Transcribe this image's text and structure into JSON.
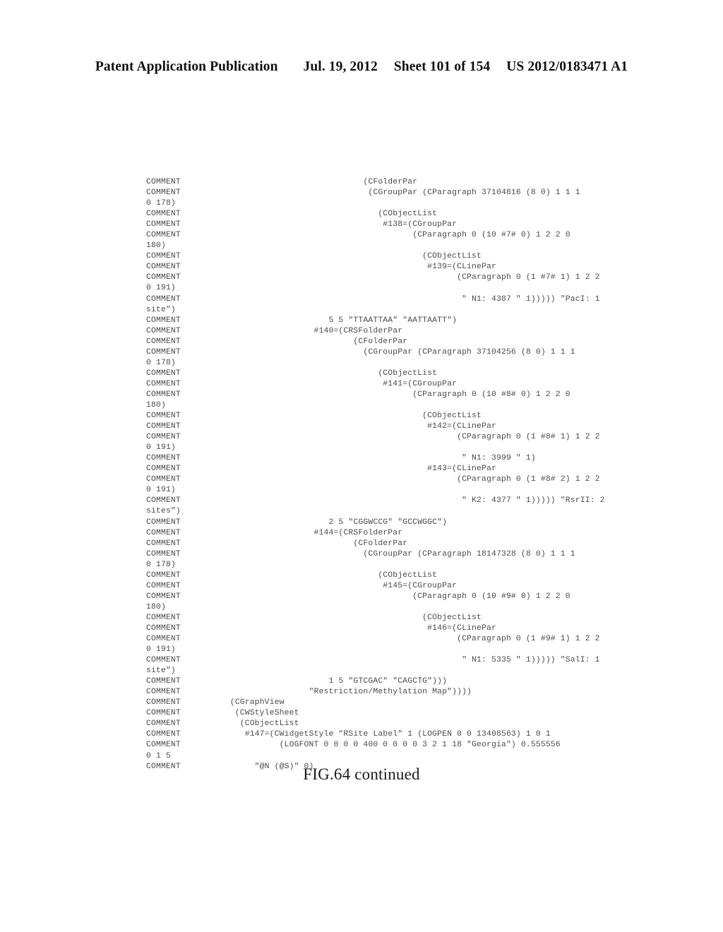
{
  "header": {
    "publication_label": "Patent Application Publication",
    "date": "Jul. 19, 2012",
    "sheet": "Sheet 101 of 154",
    "patent_number": "US 2012/0183471 A1"
  },
  "figure": {
    "caption": "FIG.64 continued"
  },
  "code_listing": {
    "lines": [
      "COMMENT                                     (CFolderPar",
      "COMMENT                                      (CGroupPar (CParagraph 37104816 (8 0) 1 1 1",
      "0 178)",
      "COMMENT                                        (CObjectList",
      "COMMENT                                         #138=(CGroupPar",
      "COMMENT                                               (CParagraph 0 (10 #7# 0) 1 2 2 0",
      "180)",
      "COMMENT                                                 (CObjectList",
      "COMMENT                                                  #139=(CLinePar",
      "COMMENT                                                        (CParagraph 0 (1 #7# 1) 1 2 2",
      "0 191)",
      "COMMENT                                                         \" N1: 4387 \" 1))))) \"PacI: 1",
      "site\")",
      "COMMENT                              5 5 \"TTAATTAA\" \"AATTAATT\")",
      "COMMENT                           #140=(CRSFolderPar",
      "COMMENT                                   (CFolderPar",
      "COMMENT                                     (CGroupPar (CParagraph 37104256 (8 0) 1 1 1",
      "0 178)",
      "COMMENT                                        (CObjectList",
      "COMMENT                                         #141=(CGroupPar",
      "COMMENT                                               (CParagraph 0 (10 #8# 0) 1 2 2 0",
      "180)",
      "COMMENT                                                 (CObjectList",
      "COMMENT                                                  #142=(CLinePar",
      "COMMENT                                                        (CParagraph 0 (1 #8# 1) 1 2 2",
      "0 191)",
      "COMMENT                                                         \" N1: 3999 \" 1)",
      "COMMENT                                                  #143=(CLinePar",
      "COMMENT                                                        (CParagraph 0 (1 #8# 2) 1 2 2",
      "0 191)",
      "COMMENT                                                         \" K2: 4377 \" 1))))) \"RsrII: 2",
      "sites\")",
      "COMMENT                              2 5 \"CGGWCCG\" \"GCCWGGC\")",
      "COMMENT                           #144=(CRSFolderPar",
      "COMMENT                                   (CFolderPar",
      "COMMENT                                     (CGroupPar (CParagraph 18147328 (8 0) 1 1 1",
      "0 178)",
      "COMMENT                                        (CObjectList",
      "COMMENT                                         #145=(CGroupPar",
      "COMMENT                                               (CParagraph 0 (10 #9# 0) 1 2 2 0",
      "180)",
      "COMMENT                                                 (CObjectList",
      "COMMENT                                                  #146=(CLinePar",
      "COMMENT                                                        (CParagraph 0 (1 #9# 1) 1 2 2",
      "0 191)",
      "COMMENT                                                         \" N1: 5335 \" 1))))) \"SalI: 1",
      "site\")",
      "COMMENT                              1 5 \"GTCGAC\" \"CAGCTG\")))",
      "COMMENT                          \"Restriction/Methylation Map\"))))",
      "COMMENT          (CGraphView",
      "COMMENT           (CWStyleSheet",
      "COMMENT            (CObjectList",
      "COMMENT             #147=(CWidgetStyle \"RSite Label\" 1 (LOGPEN 0 0 13408563) 1 0 1",
      "COMMENT                    (LOGFONT 0 0 0 0 400 0 0 0 0 3 2 1 18 \"Georgia\") 0.555556",
      "0 1 5",
      "COMMENT               \"@N (@S)\" 0)"
    ]
  }
}
